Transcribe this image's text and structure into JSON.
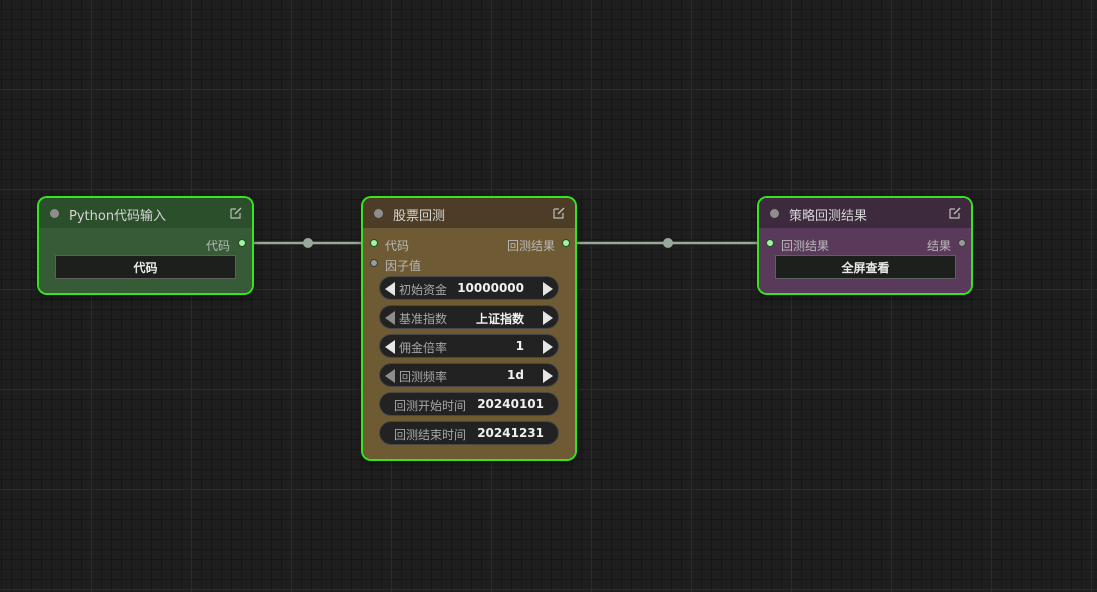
{
  "nodes": {
    "python_input": {
      "title": "Python代码输入",
      "output_label": "代码",
      "button_label": "代码",
      "header_color": "#2b4e2b",
      "body_color": "#365b36"
    },
    "stock_backtest": {
      "title": "股票回测",
      "inputs": [
        "代码",
        "因子值"
      ],
      "output_label": "回测结果",
      "header_color": "#4d3d26",
      "body_color": "#6f5b33",
      "widgets": [
        {
          "label": "初始资金",
          "value": "10000000"
        },
        {
          "label": "基准指数",
          "value": "上证指数"
        },
        {
          "label": "佣金倍率",
          "value": "1"
        },
        {
          "label": "回测频率",
          "value": "1d"
        },
        {
          "label": "回测开始时间",
          "value": "20240101"
        },
        {
          "label": "回测结束时间",
          "value": "20241231"
        }
      ]
    },
    "backtest_result": {
      "title": "策略回测结果",
      "input_label": "回测结果",
      "output_label": "结果",
      "button_label": "全屏查看",
      "header_color": "#3d2a3d",
      "body_color": "#5a3a5a"
    }
  },
  "colors": {
    "selection_outline": "#36e51f",
    "link": "#9aa89a",
    "connected_slot": "#9df79d"
  }
}
